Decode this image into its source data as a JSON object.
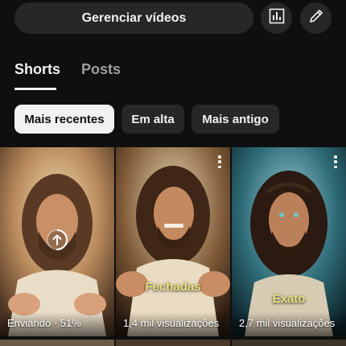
{
  "header": {
    "manage_label": "Gerenciar vídeos",
    "analytics_icon": "bar-chart-icon",
    "edit_icon": "pencil-icon"
  },
  "tabs": [
    {
      "label": "Shorts",
      "active": true
    },
    {
      "label": "Posts",
      "active": false
    }
  ],
  "filters": [
    {
      "label": "Mais recentes",
      "selected": true
    },
    {
      "label": "Em alta",
      "selected": false
    },
    {
      "label": "Mais antigo",
      "selected": false
    }
  ],
  "videos": [
    {
      "status": "Enviando · 51%",
      "overlay": "",
      "upload_progress": 0.51,
      "menu_icon": "more-vert-icon"
    },
    {
      "status": "1,4 mil visualizações",
      "overlay": "Fechadas",
      "menu_icon": "more-vert-icon"
    },
    {
      "status": "2,7 mil visualizações",
      "overlay": "Exato",
      "menu_icon": "more-vert-icon"
    }
  ],
  "colors": {
    "background": "#0f0f0f",
    "surface": "#272727",
    "text": "#f1f1f1",
    "muted": "#9e9e9e",
    "overlay_text": "#e8e27a"
  }
}
